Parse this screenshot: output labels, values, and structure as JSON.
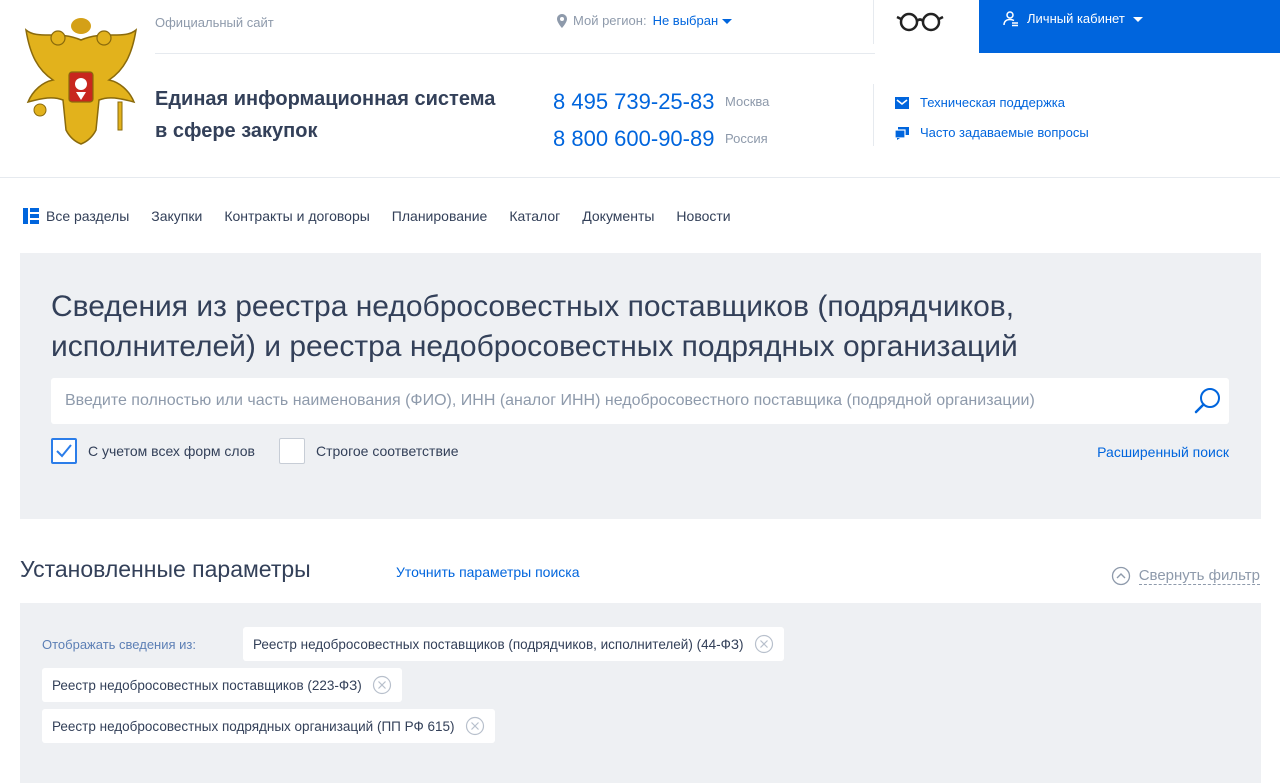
{
  "header": {
    "official_site": "Официальный сайт",
    "region_label": "Мой регион:",
    "region_value": "Не выбран",
    "cabinet_label": "Личный кабинет",
    "title_line1": "Единая информационная система",
    "title_line2": "в сфере закупок",
    "phones": [
      {
        "number": "8 495 739-25-83",
        "city": "Москва"
      },
      {
        "number": "8 800 600-90-89",
        "city": "Россия"
      }
    ],
    "support_label": "Техническая поддержка",
    "faq_label": "Часто задаваемые вопросы"
  },
  "nav": {
    "items": [
      {
        "label": "Все разделы",
        "icon": "sections-icon"
      },
      {
        "label": "Закупки"
      },
      {
        "label": "Контракты и договоры"
      },
      {
        "label": "Планирование"
      },
      {
        "label": "Каталог"
      },
      {
        "label": "Документы"
      },
      {
        "label": "Новости"
      }
    ]
  },
  "search": {
    "title": "Сведения из реестра недобросовестных поставщиков (подрядчиков, исполнителей) и реестра недобросовестных подрядных организаций",
    "placeholder": "Введите полностью или часть наименования (ФИО), ИНН (аналог ИНН) недобросовестного поставщика (подрядной организации)",
    "value": "",
    "options": [
      {
        "label": "С учетом всех форм слов",
        "checked": true
      },
      {
        "label": "Строгое соответствие",
        "checked": false
      }
    ],
    "advanced_label": "Расширенный поиск"
  },
  "params": {
    "title": "Установленные параметры",
    "refine_label": "Уточнить параметры поиска",
    "collapse_label": "Свернуть фильтр",
    "display_from_label": "Отображать сведения из:",
    "chips": [
      "Реестр недобросовестных поставщиков (подрядчиков, исполнителей) (44-ФЗ)",
      "Реестр недобросовестных поставщиков (223-ФЗ)",
      "Реестр недобросовестных подрядных организаций (ПП РФ 615)"
    ]
  },
  "colors": {
    "accent": "#0065dd",
    "text": "#334059",
    "muted": "#8e9aab",
    "panel_bg": "#eef0f3"
  }
}
